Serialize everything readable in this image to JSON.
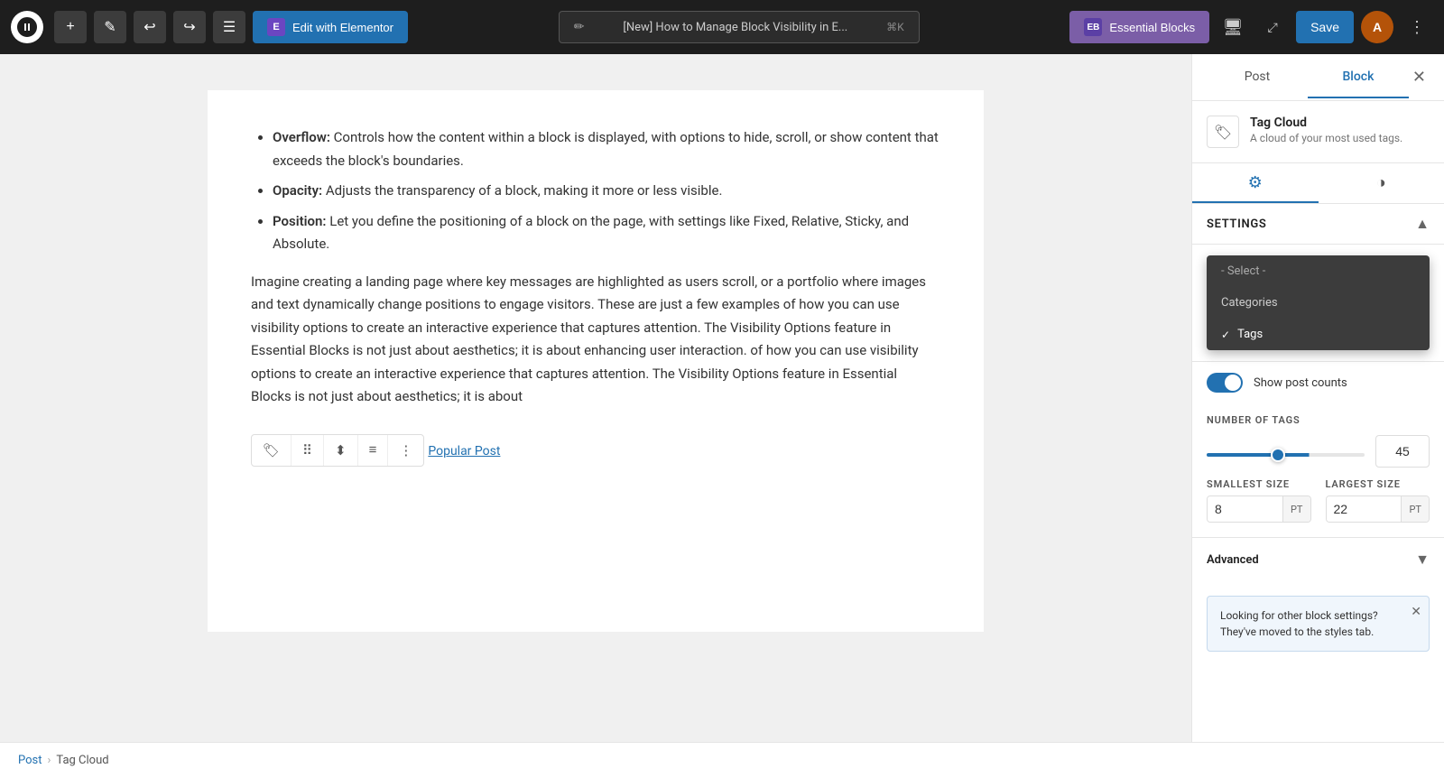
{
  "toolbar": {
    "edit_elementor_label": "Edit with Elementor",
    "elementor_icon": "E",
    "post_title": "[New] How to Manage Block Visibility in E...",
    "shortcut": "⌘K",
    "essential_blocks_label": "Essential Blocks",
    "save_label": "Save",
    "avatar_initials": "A"
  },
  "panel": {
    "post_tab": "Post",
    "block_tab": "Block",
    "block_name": "Tag Cloud",
    "block_desc": "A cloud of your most used tags.",
    "settings_label": "Settings",
    "advanced_label": "Advanced"
  },
  "dropdown": {
    "placeholder": "- Select -",
    "categories_label": "Categories",
    "tags_label": "Tags"
  },
  "settings": {
    "show_post_counts_label": "Show post counts",
    "number_of_tags_label": "NUMBER OF TAGS",
    "number_of_tags_value": "45",
    "smallest_size_label": "SMALLEST SIZE",
    "smallest_size_value": "8",
    "smallest_size_unit": "PT",
    "largest_size_label": "LARGEST SIZE",
    "largest_size_value": "22",
    "largest_size_unit": "PT"
  },
  "notification": {
    "text": "Looking for other block settings? They've moved to the styles tab."
  },
  "content": {
    "bullet1_bold": "Overflow:",
    "bullet1_text": " Controls how the content within a block is displayed, with options to hide, scroll, or show content that exceeds the block's boundaries.",
    "bullet2_bold": "Opacity:",
    "bullet2_text": " Adjusts the transparency of a block, making it more or less visible.",
    "bullet3_bold": "Position:",
    "bullet3_text": " Let you define the positioning of a block on the page, with settings like Fixed, Relative, Sticky, and Absolute.",
    "paragraph1": "Imagine creating a landing page where key messages are highlighted as users scroll, or a portfolio where images and text dynamically change positions to engage visitors. These are just a few examples of how you can use visibility options to create an interactive experience that captures attention. The Visibility Options feature in Essential Blocks is not just about aesthetics; it is about enhancing user interaction. of how you can use visibility options to create an interactive experience that captures attention. The Visibility Options feature in Essential Blocks is not just about aesthetics; it is about",
    "popular_post_label": "Popular Post"
  },
  "breadcrumb": {
    "post_label": "Post",
    "tag_cloud_label": "Tag Cloud"
  }
}
